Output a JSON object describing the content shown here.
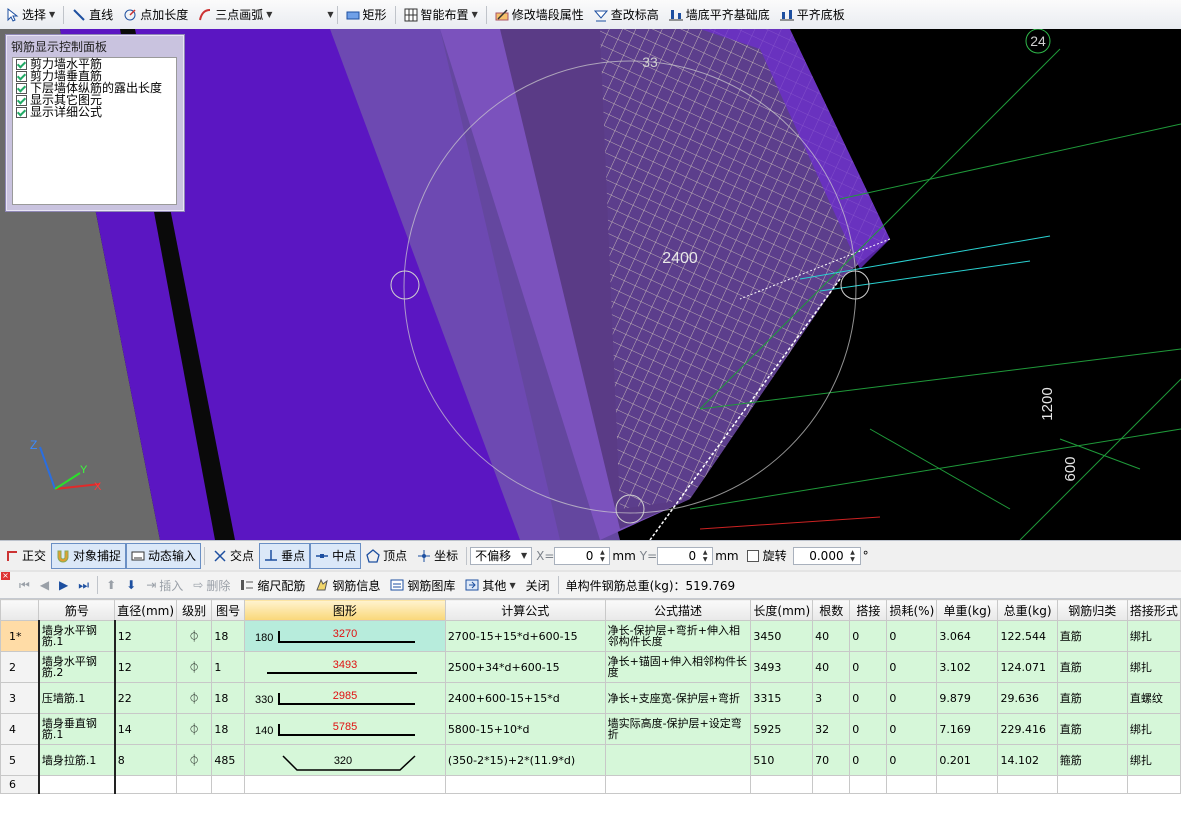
{
  "top_toolbar": {
    "select": "选择",
    "line": "直线",
    "point_length": "点加长度",
    "arc3": "三点画弧",
    "rect": "矩形",
    "smart_layout": "智能布置",
    "modify_wall_attr": "修改墙段属性",
    "check_elevation": "查改标高",
    "align_foundation": "墙底平齐基础底",
    "align_bottom": "平齐底板"
  },
  "viewport": {
    "dim_top": "33",
    "axis_label": "24",
    "dim_center": "2400",
    "dim_1200": "1200",
    "dim_600": "600",
    "axes": {
      "z": "Z",
      "y": "Y",
      "x": "X"
    }
  },
  "rebar_panel": {
    "title": "钢筋显示控制面板",
    "items": [
      "剪力墙水平筋",
      "剪力墙垂直筋",
      "下层墙体纵筋的露出长度",
      "显示其它图元",
      "显示详细公式"
    ]
  },
  "snap_toolbar": {
    "ortho": "正交",
    "object_snap": "对象捕捉",
    "dynamic_input": "动态输入",
    "intersection": "交点",
    "perpendicular": "垂点",
    "midpoint": "中点",
    "vertex": "顶点",
    "coordinate": "坐标",
    "offset_mode": "不偏移",
    "x_label": "X=",
    "x_value": "0",
    "y_label": "Y=",
    "y_value": "0",
    "unit_mm": "mm",
    "rotate_label": "旋转",
    "rotate_value": "0.000",
    "degree": "°"
  },
  "grid_toolbar": {
    "insert": "插入",
    "delete": "删除",
    "scale_rebar": "缩尺配筋",
    "rebar_info": "钢筋信息",
    "rebar_library": "钢筋图库",
    "other": "其他",
    "close": "关闭",
    "total_weight": "单构件钢筋总重(kg)：519.769"
  },
  "table": {
    "headers": [
      "筋号",
      "直径(mm)",
      "级别",
      "图号",
      "图形",
      "计算公式",
      "公式描述",
      "长度(mm)",
      "根数",
      "搭接",
      "损耗(%)",
      "单重(kg)",
      "总重(kg)",
      "钢筋归类",
      "搭接形式"
    ],
    "rows": [
      {
        "no": "1*",
        "name": "墙身水平钢筋.1",
        "dia": "12",
        "grade": "⏀",
        "fig": "18",
        "shape_left": "180",
        "shape_val": "3270",
        "formula": "2700-15+15*d+600-15",
        "desc": "净长-保护层+弯折+伸入相邻构件长度",
        "length": "3450",
        "count": "40",
        "lap": "0",
        "loss": "0",
        "unit_w": "3.064",
        "total_w": "122.544",
        "category": "直筋",
        "lap_type": "绑扎"
      },
      {
        "no": "2",
        "name": "墙身水平钢筋.2",
        "dia": "12",
        "grade": "⏀",
        "fig": "1",
        "shape_left": "",
        "shape_val": "3493",
        "formula": "2500+34*d+600-15",
        "desc": "净长+锚固+伸入相邻构件长度",
        "length": "3493",
        "count": "40",
        "lap": "0",
        "loss": "0",
        "unit_w": "3.102",
        "total_w": "124.071",
        "category": "直筋",
        "lap_type": "绑扎"
      },
      {
        "no": "3",
        "name": "压墙筋.1",
        "dia": "22",
        "grade": "⏀",
        "fig": "18",
        "shape_left": "330",
        "shape_val": "2985",
        "formula": "2400+600-15+15*d",
        "desc": "净长+支座宽-保护层+弯折",
        "length": "3315",
        "count": "3",
        "lap": "0",
        "loss": "0",
        "unit_w": "9.879",
        "total_w": "29.636",
        "category": "直筋",
        "lap_type": "直螺纹"
      },
      {
        "no": "4",
        "name": "墙身垂直钢筋.1",
        "dia": "14",
        "grade": "⏀",
        "fig": "18",
        "shape_left": "140",
        "shape_val": "5785",
        "formula": "5800-15+10*d",
        "desc": "墙实际高度-保护层+设定弯折",
        "length": "5925",
        "count": "32",
        "lap": "0",
        "loss": "0",
        "unit_w": "7.169",
        "total_w": "229.416",
        "category": "直筋",
        "lap_type": "绑扎"
      },
      {
        "no": "5",
        "name": "墙身拉筋.1",
        "dia": "8",
        "grade": "⏀",
        "fig": "485",
        "shape_left": "",
        "shape_val": "320",
        "formula": "(350-2*15)+2*(11.9*d)",
        "desc": "",
        "length": "510",
        "count": "70",
        "lap": "0",
        "loss": "0",
        "unit_w": "0.201",
        "total_w": "14.102",
        "category": "箍筋",
        "lap_type": "绑扎"
      }
    ],
    "empty_row_no": "6"
  }
}
